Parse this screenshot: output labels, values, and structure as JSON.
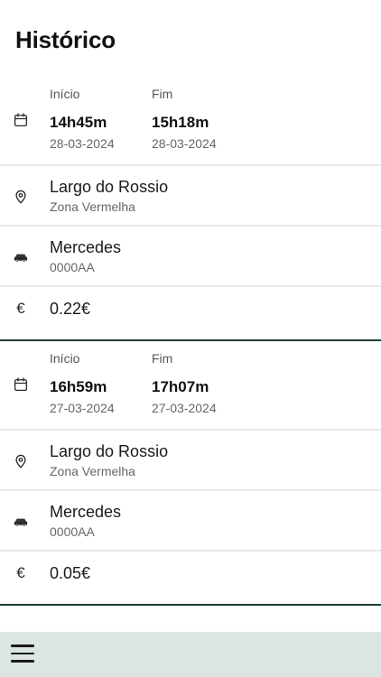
{
  "page": {
    "title": "Histórico"
  },
  "labels": {
    "start": "Início",
    "end": "Fim"
  },
  "entries": [
    {
      "start_time": "14h45m",
      "start_date": "28-03-2024",
      "end_time": "15h18m",
      "end_date": "28-03-2024",
      "location": "Largo do Rossio",
      "zone": "Zona Vermelha",
      "vehicle": "Mercedes",
      "plate": "0000AA",
      "price": "0.22€"
    },
    {
      "start_time": "16h59m",
      "start_date": "27-03-2024",
      "end_time": "17h07m",
      "end_date": "27-03-2024",
      "location": "Largo do Rossio",
      "zone": "Zona Vermelha",
      "vehicle": "Mercedes",
      "plate": "0000AA",
      "price": "0.05€"
    }
  ],
  "icons": {
    "calendar": "calendar-icon",
    "location": "location-pin-icon",
    "vehicle": "car-icon",
    "currency": "euro-icon",
    "menu": "hamburger-menu-icon"
  },
  "colors": {
    "separator": "#1f3d33",
    "bottom_bar": "#dbe5e1"
  }
}
